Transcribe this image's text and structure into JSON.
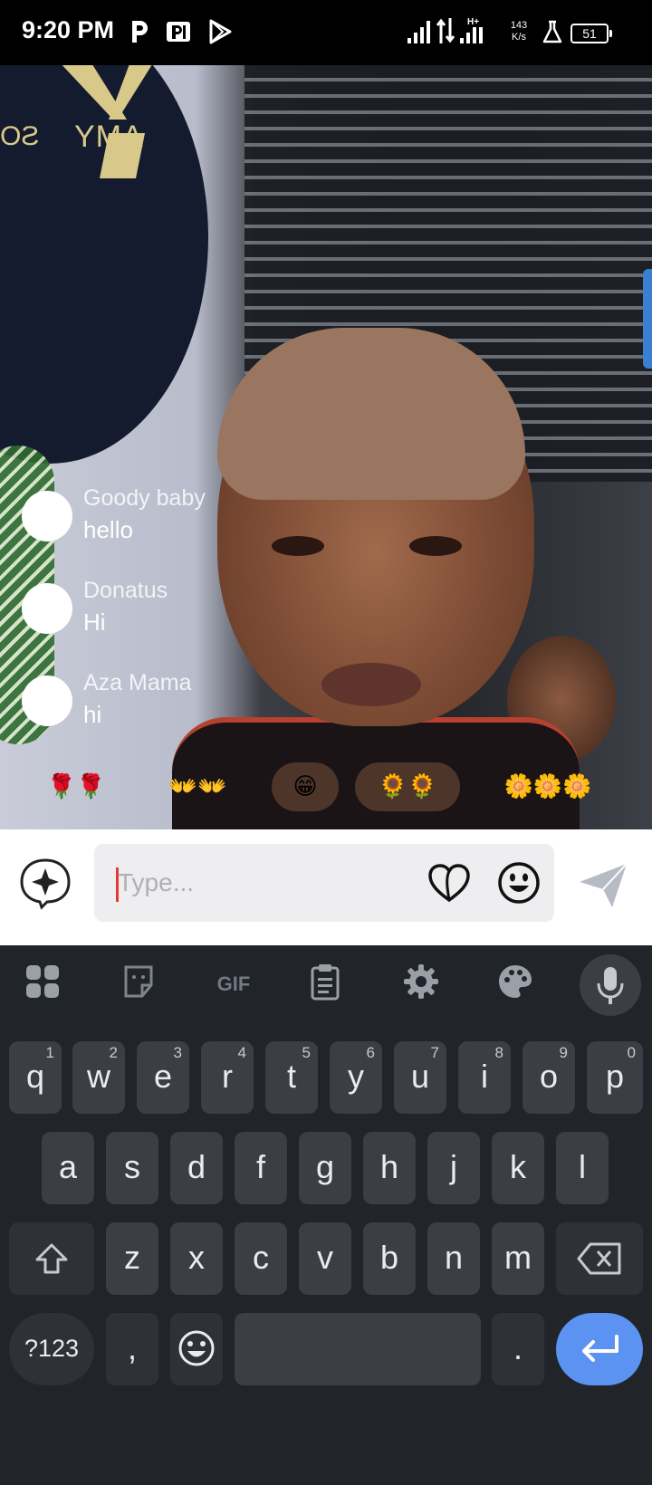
{
  "status_bar": {
    "time": "9:20 PM",
    "net_speed_value": "143",
    "net_speed_unit": "K/s",
    "battery": "51",
    "icons": [
      "p-app-icon",
      "parking-app-icon",
      "play-store-icon",
      "signal-icon",
      "data-arrows-icon",
      "signal-hplus-icon",
      "lab-flask-icon",
      "battery-icon"
    ]
  },
  "video": {
    "logo_text": "YMA",
    "logo_text_mirrored": "SO"
  },
  "comments": [
    {
      "name": "Goody baby",
      "text": "hello"
    },
    {
      "name": "Donatus",
      "text": "Hi"
    },
    {
      "name": "Aza Mama",
      "text": "hi"
    }
  ],
  "reactions": [
    "🌹🌹",
    "👐👐",
    "😁",
    "🌻🌻",
    "🌼🌼🌼"
  ],
  "message_bar": {
    "placeholder": "Type...",
    "icons": [
      "ai-sparkle-icon",
      "heart-icon",
      "emoji-icon",
      "send-icon"
    ]
  },
  "keyboard": {
    "toolbar": [
      "apps-grid-icon",
      "sticker-icon",
      "GIF",
      "clipboard-icon",
      "settings-icon",
      "palette-icon",
      "mic-icon"
    ],
    "row1": [
      "q",
      "w",
      "e",
      "r",
      "t",
      "y",
      "u",
      "i",
      "o",
      "p"
    ],
    "row1_hints": [
      "1",
      "2",
      "3",
      "4",
      "5",
      "6",
      "7",
      "8",
      "9",
      "0"
    ],
    "row2": [
      "a",
      "s",
      "d",
      "f",
      "g",
      "h",
      "j",
      "k",
      "l"
    ],
    "row3": [
      "z",
      "x",
      "c",
      "v",
      "b",
      "n",
      "m"
    ],
    "sym_key": "?123",
    "comma_key": ",",
    "period_key": ".",
    "accent": "#5c93f2"
  }
}
